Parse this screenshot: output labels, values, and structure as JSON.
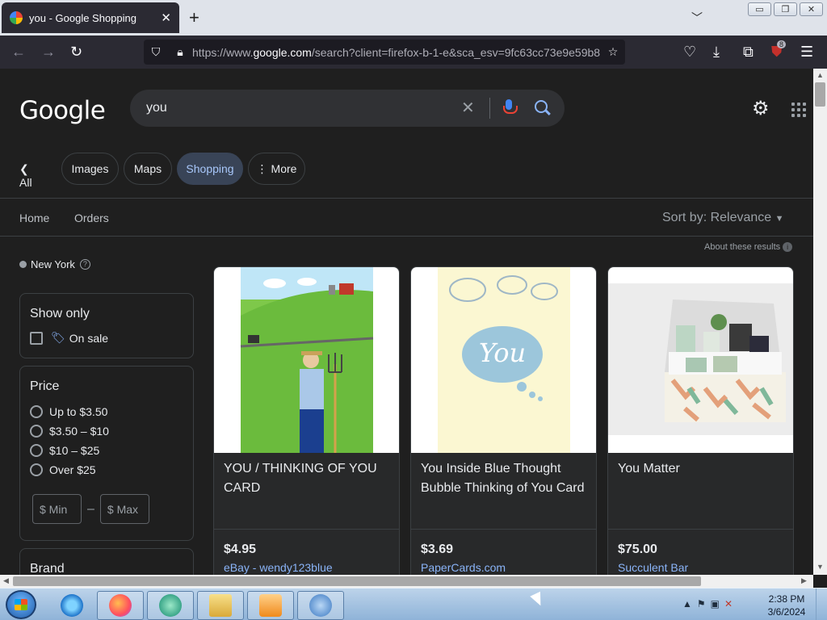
{
  "browser": {
    "tab_title": "you - Google Shopping",
    "url_prefix": "https://www.",
    "url_domain": "google.com",
    "url_rest": "/search?client=firefox-b-1-e&sca_esv=9fc63cc73e9e59b8",
    "extension_badge": "8"
  },
  "google": {
    "logo": "Google",
    "query": "you",
    "chips": {
      "all": "All",
      "images": "Images",
      "maps": "Maps",
      "shopping": "Shopping",
      "more": "More"
    },
    "subnav": {
      "home": "Home",
      "orders": "Orders"
    },
    "sort_prefix": "Sort by:",
    "sort_value": "Relevance",
    "about": "About these results",
    "location": "New York"
  },
  "filters": {
    "show_only": {
      "title": "Show only",
      "on_sale": "On sale"
    },
    "price": {
      "title": "Price",
      "options": [
        "Up to $3.50",
        "$3.50 – $10",
        "$10 – $25",
        "Over $25"
      ],
      "min_placeholder": "$ Min",
      "max_placeholder": "$ Max"
    },
    "brand": {
      "title": "Brand"
    }
  },
  "products": [
    {
      "title": "YOU / THINKING OF YOU CARD",
      "price": "$4.95",
      "seller": "eBay - wendy123blue"
    },
    {
      "title": "You Inside Blue Thought Bubble Thinking of You Card",
      "price": "$3.69",
      "seller": "PaperCards.com",
      "image_text": "You"
    },
    {
      "title": "You Matter",
      "price": "$75.00",
      "seller": "Succulent Bar"
    }
  ],
  "taskbar": {
    "time": "2:38 PM",
    "date": "3/6/2024"
  }
}
